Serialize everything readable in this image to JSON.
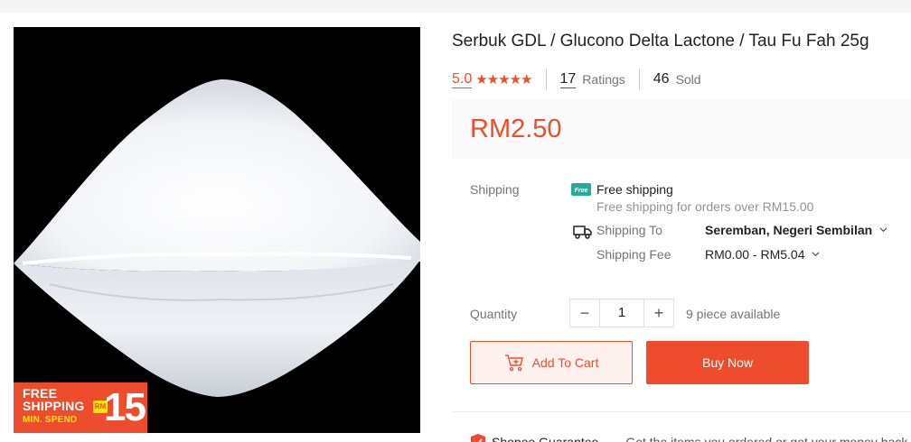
{
  "product": {
    "title": "Serbuk GDL / Glucono Delta Lactone / Tau Fu Fah 25g",
    "rating": "5.0",
    "stars": "★★★★★",
    "ratings_count": "17",
    "ratings_label": "Ratings",
    "sold_count": "46",
    "sold_label": "Sold",
    "price": "RM2.50"
  },
  "image_badge": {
    "line1": "FREE",
    "line2": "SHIPPING",
    "line3": "MIN. SPEND",
    "currency": "RM",
    "amount": "15"
  },
  "shipping": {
    "label": "Shipping",
    "free_tag": "Free",
    "free_title": "Free shipping",
    "free_subtitle": "Free shipping for orders over RM15.00",
    "to_label": "Shipping To",
    "to_value": "Seremban, Negeri Sembilan",
    "fee_label": "Shipping Fee",
    "fee_value": "RM0.00 - RM5.04"
  },
  "quantity": {
    "label": "Quantity",
    "minus": "−",
    "value": "1",
    "plus": "+",
    "available": "9 piece available"
  },
  "actions": {
    "add_to_cart": "Add To Cart",
    "buy_now": "Buy Now"
  },
  "guarantee": {
    "title": "Shopee Guarantee",
    "subtitle": "Get the items you ordered or get your money back"
  },
  "colors": {
    "brand": "#ee4d2d",
    "badge_yellow": "#ffe400"
  }
}
